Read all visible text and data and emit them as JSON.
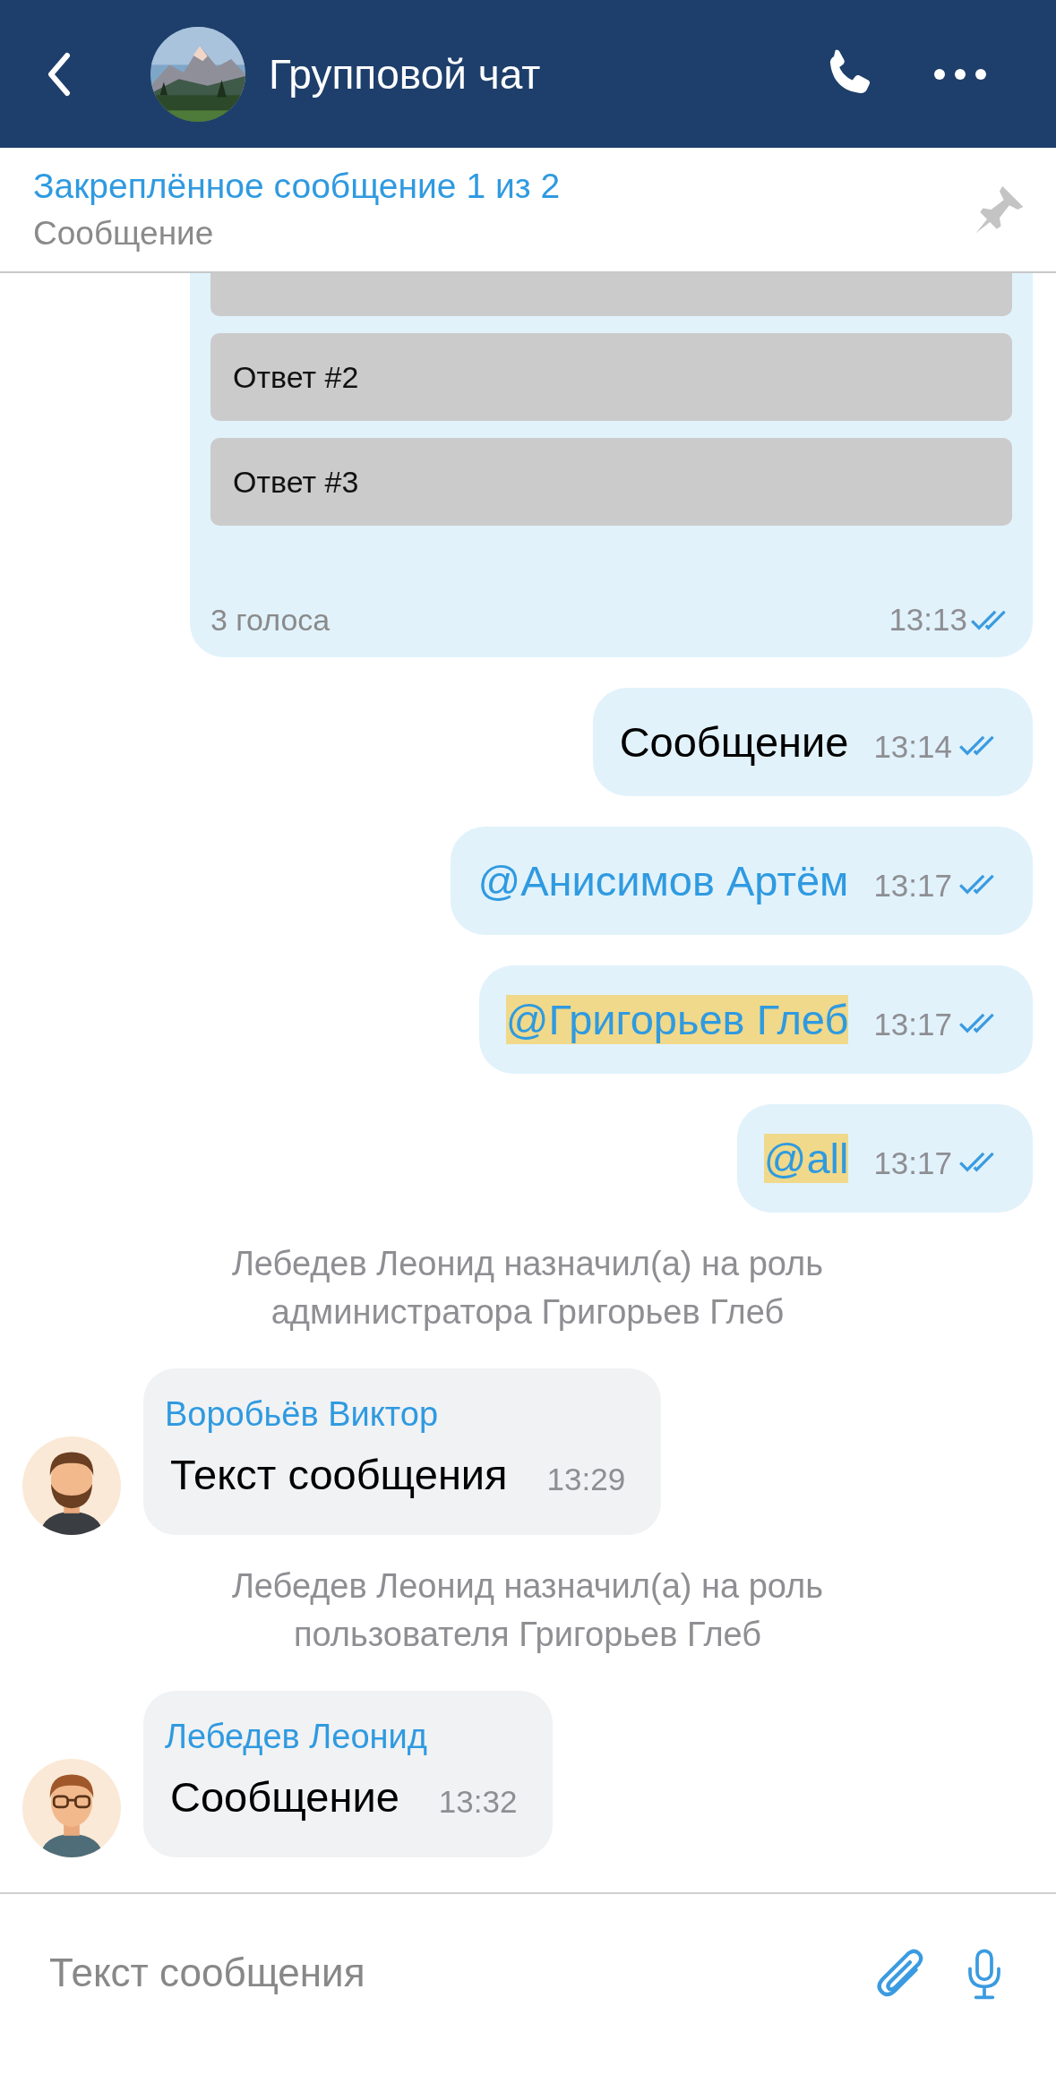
{
  "header": {
    "title": "Групповой чат"
  },
  "pinned": {
    "title": "Закреплённое сообщение 1 из 2",
    "text": "Сообщение"
  },
  "messages": [
    {
      "kind": "poll",
      "options": [
        "Ответ #2",
        "Ответ #3"
      ],
      "votes": "3 голоса",
      "time": "13:13",
      "read": true
    },
    {
      "kind": "outgoing",
      "text": "Сообщение",
      "mention": false,
      "highlighted": false,
      "time": "13:14",
      "read": true
    },
    {
      "kind": "outgoing",
      "text": "@Анисимов Артём",
      "mention": true,
      "highlighted": false,
      "time": "13:17",
      "read": true
    },
    {
      "kind": "outgoing",
      "text": "@Григорьев Глеб",
      "mention": true,
      "highlighted": true,
      "time": "13:17",
      "read": true
    },
    {
      "kind": "outgoing",
      "text": "@all",
      "mention": true,
      "highlighted": true,
      "time": "13:17",
      "read": true
    },
    {
      "kind": "system",
      "text": "Лебедев Леонид назначил(а) на роль администратора Григорьев Глеб"
    },
    {
      "kind": "incoming",
      "sender": "Воробьёв Виктор",
      "text": "Текст сообщения",
      "time": "13:29",
      "avatar": {
        "kind": "beard"
      }
    },
    {
      "kind": "system",
      "text": "Лебедев Леонид назначил(а) на роль пользователя Григорьев Глеб"
    },
    {
      "kind": "incoming",
      "sender": "Лебедев Леонид",
      "text": "Сообщение",
      "time": "13:32",
      "avatar": {
        "kind": "glasses"
      }
    }
  ],
  "composer": {
    "placeholder": "Текст сообщения"
  }
}
